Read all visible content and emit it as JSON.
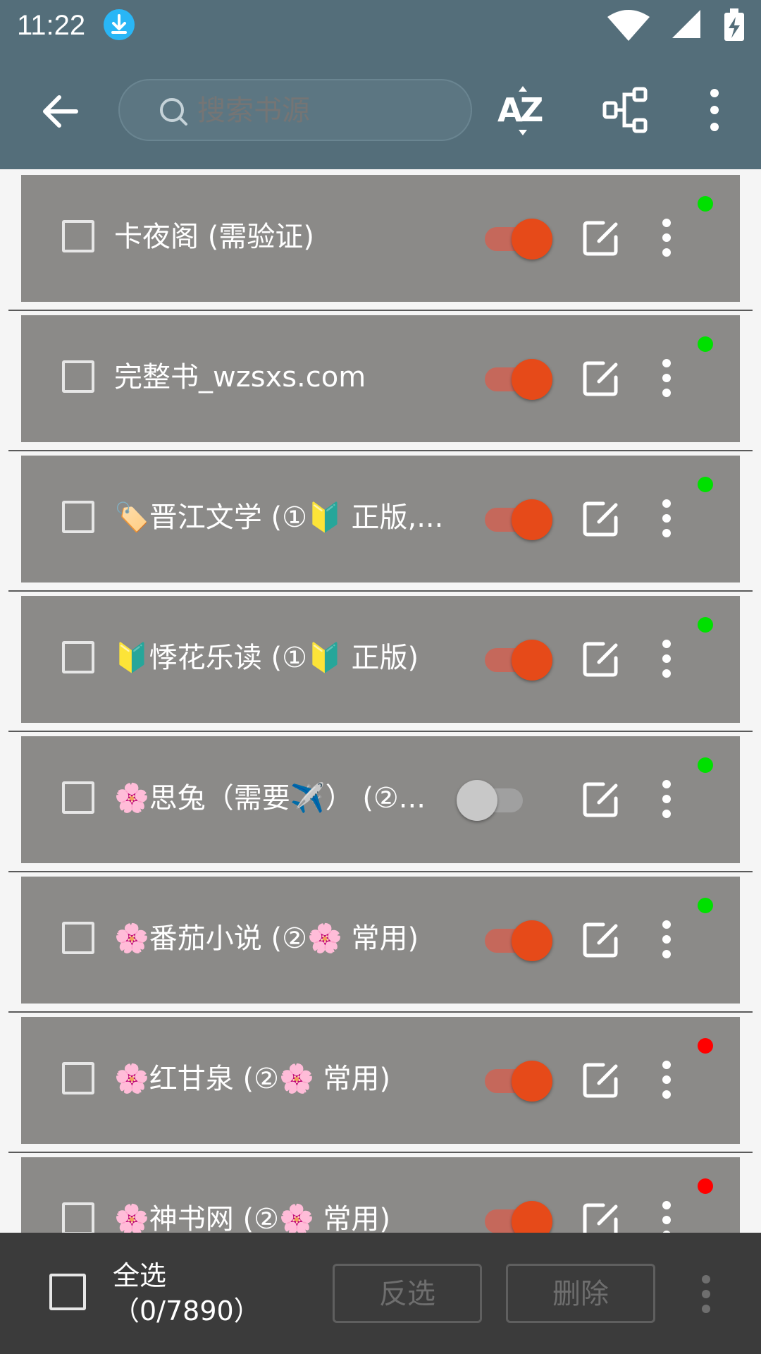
{
  "status_bar": {
    "time": "11:22",
    "download_icon": "download-notification-icon",
    "wifi_icon": "wifi-icon",
    "signal_icon": "cell-signal-icon",
    "battery_icon": "battery-charging-icon"
  },
  "toolbar": {
    "back_icon": "arrow-back-icon",
    "search_placeholder": "搜索书源",
    "sort_icon": "sort-az-icon",
    "group_icon": "group-tree-icon",
    "more_icon": "more-vert-icon"
  },
  "sources": [
    {
      "name": "卡夜阁 (需验证)",
      "enabled": true,
      "status_color": "#00e000"
    },
    {
      "name": "完整书_wzsxs.com",
      "enabled": true,
      "status_color": "#00e000"
    },
    {
      "name": "🏷️晋江文学 (①🔰 正版,...",
      "enabled": true,
      "status_color": "#00e000"
    },
    {
      "name": "🔰悸花乐读 (①🔰 正版)",
      "enabled": true,
      "status_color": "#00e000"
    },
    {
      "name": "🌸思兔（需要✈️） (②...",
      "enabled": false,
      "status_color": "#00e000"
    },
    {
      "name": "🌸番茄小说 (②🌸 常用)",
      "enabled": true,
      "status_color": "#00e000"
    },
    {
      "name": "🌸红甘泉 (②🌸 常用)",
      "enabled": true,
      "status_color": "#ff0000"
    },
    {
      "name": "🌸神书网 (②🌸 常用)",
      "enabled": true,
      "status_color": "#ff0000"
    }
  ],
  "bottom_bar": {
    "select_all_label": "全选",
    "select_count": "（0/7890）",
    "invert_label": "反选",
    "delete_label": "删除"
  },
  "colors": {
    "toolbar": "#546e7a",
    "card": "#8b8a88",
    "accent": "#e64a19",
    "bottom_bar": "#3b3b3b"
  }
}
